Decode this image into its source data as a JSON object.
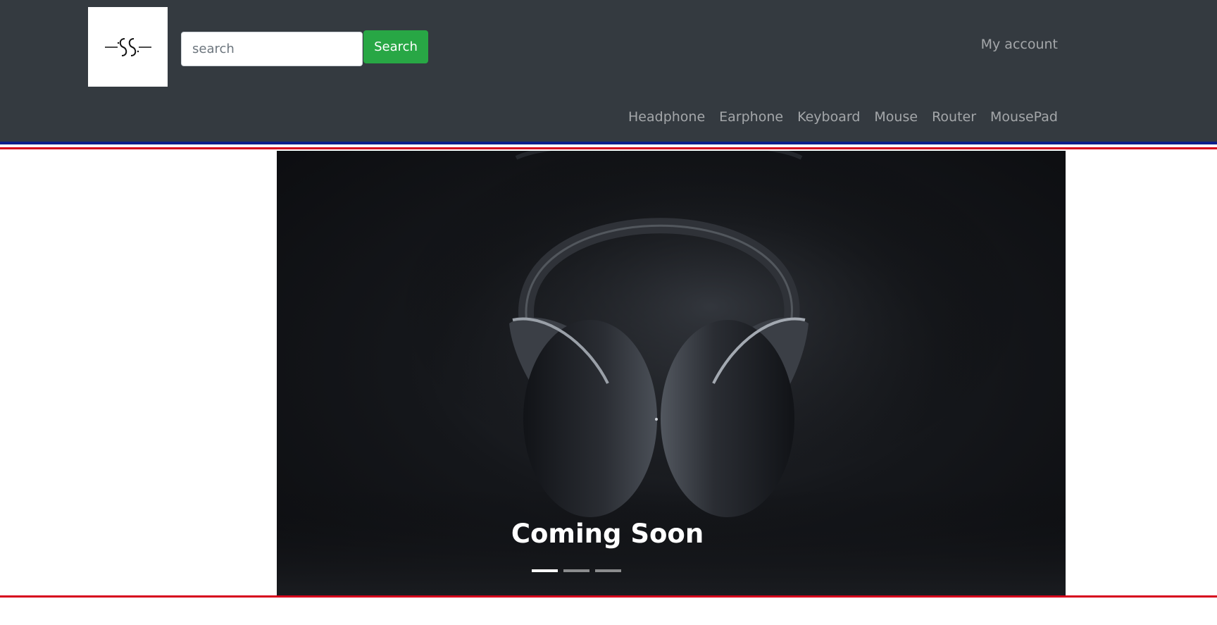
{
  "header": {
    "logo_text": "SS",
    "search": {
      "placeholder": "search",
      "value": "",
      "button_label": "Search"
    },
    "account_label": "My account",
    "categories": [
      "Headphone",
      "Earphone",
      "Keyboard",
      "Mouse",
      "Router",
      "MousePad"
    ]
  },
  "carousel": {
    "caption": "Coming Soon",
    "slide_count": 3,
    "active_slide": 1
  },
  "colors": {
    "navbar_bg": "#343a40",
    "search_button": "#28a745",
    "stripe_blue": "#0d1f8c",
    "stripe_red": "#d6001c"
  }
}
